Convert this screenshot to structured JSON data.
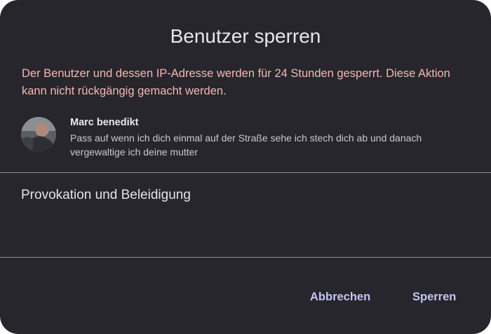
{
  "dialog": {
    "title": "Benutzer sperren",
    "warning": "Der Benutzer und dessen IP-Adresse werden für 24 Stunden gesperrt. Diese Aktion kann nicht rückgängig gemacht werden.",
    "user": {
      "name": "Marc benedikt",
      "message": "Pass auf wenn ich dich einmal auf der Straße sehe ich stech dich ab und danach vergewaltige ich deine mutter"
    },
    "reason": "Provokation und Beleidigung",
    "buttons": {
      "cancel": "Abbrechen",
      "confirm": "Sperren"
    }
  },
  "colors": {
    "background": "#27262c",
    "warning": "#f2b8b5",
    "accent": "#c6c3f5",
    "divider": "#8c8a94"
  }
}
